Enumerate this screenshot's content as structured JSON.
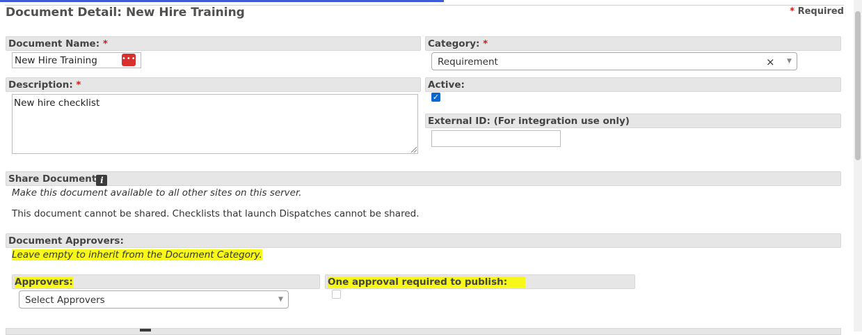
{
  "header": {
    "title": "Document Detail: New Hire Training",
    "required_asterisk": "*",
    "required_label": "Required"
  },
  "document_name": {
    "label": "Document Name:",
    "asterisk": "*",
    "value": "New Hire Training",
    "menu_button_glyph": "•••"
  },
  "category": {
    "label": "Category:",
    "asterisk": "*",
    "selected": "Requirement",
    "clear_glyph": "×"
  },
  "description": {
    "label": "Description:",
    "asterisk": "*",
    "value": "New hire checklist"
  },
  "active": {
    "label": "Active:",
    "checked": true,
    "check_glyph": "✓"
  },
  "external_id": {
    "label": "External ID: (For integration use only)",
    "value": ""
  },
  "share": {
    "label": "Share Document",
    "info_glyph": "i",
    "hint": "Make this document available to all other sites on this server.",
    "message": "This document cannot be shared. Checklists that launch Dispatches cannot be shared."
  },
  "approvers_section": {
    "label": "Document Approvers:",
    "hint": "Leave empty to inherit from the Document Category.",
    "approvers_label": "Approvers:",
    "approvers_placeholder": "Select Approvers",
    "one_approval_label": "One approval required to publish:",
    "one_approval_checked": false
  },
  "icons": {
    "menu": "more-dots-icon",
    "info": "info-icon",
    "caret": "chevron-down-icon",
    "clear": "clear-icon",
    "check": "check-icon"
  },
  "colors": {
    "accent": "#3f5bd8",
    "required": "#d21a1a",
    "checkbox": "#0a67d1",
    "highlight": "#f7f71a",
    "menu_button": "#d9302e"
  }
}
